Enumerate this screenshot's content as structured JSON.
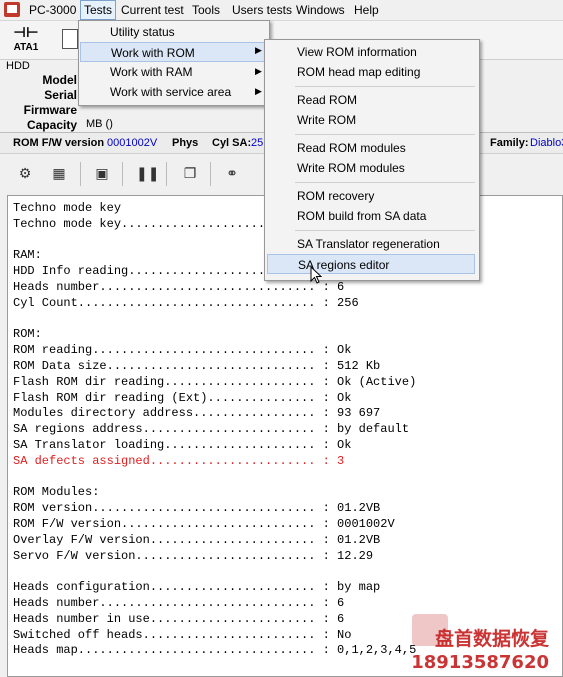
{
  "menubar": {
    "app_title": "PC-3000",
    "items": [
      "Tests",
      "Current test",
      "Tools",
      "Users tests",
      "Windows",
      "Help"
    ]
  },
  "toolbar": {
    "ata_label": "ATA1"
  },
  "hdd_panel": {
    "group_label": "HDD",
    "fields": [
      {
        "label": "Model",
        "value": ""
      },
      {
        "label": "Serial",
        "value": ""
      },
      {
        "label": "Firmware",
        "value": ""
      },
      {
        "label": "Capacity",
        "value": "MB ()"
      }
    ]
  },
  "infobar": {
    "rom_fw_label": "ROM F/W version",
    "rom_fw_value": "0001002V",
    "phys_label": "Phys",
    "cyl_sa_label": "Cyl SA:",
    "cyl_sa_value": "25",
    "family_label": "Family:",
    "family_value": "Diablo3"
  },
  "tests_menu": {
    "items": [
      {
        "label": "Utility status",
        "submenu": false
      },
      {
        "label": "Work with ROM",
        "submenu": true,
        "highlighted": true
      },
      {
        "label": "Work with RAM",
        "submenu": true
      },
      {
        "label": "Work with service area",
        "submenu": true
      }
    ]
  },
  "rom_menu": {
    "items": [
      {
        "label": "View ROM information"
      },
      {
        "label": "ROM head map editing"
      },
      {
        "label": "Read ROM"
      },
      {
        "label": "Write ROM"
      },
      {
        "label": "Read ROM modules"
      },
      {
        "label": "Write ROM modules"
      },
      {
        "label": "ROM recovery"
      },
      {
        "label": "ROM build from SA data"
      },
      {
        "label": "SA Translator regeneration"
      },
      {
        "label": "SA regions editor",
        "highlighted": true
      }
    ]
  },
  "console": {
    "lines": [
      {
        "text": "Techno mode key",
        "color": "#000000"
      },
      {
        "text": "Techno mode key...........................",
        "color": "#000000"
      },
      {
        "text": "",
        "color": "#000000"
      },
      {
        "text": "RAM:",
        "color": "#000000"
      },
      {
        "text": "HDD Info reading..........................",
        "color": "#000000"
      },
      {
        "text": "Heads number.............................. : 6",
        "color": "#000000"
      },
      {
        "text": "Cyl Count................................. : 256",
        "color": "#000000"
      },
      {
        "text": "",
        "color": "#000000"
      },
      {
        "text": "ROM:",
        "color": "#000000"
      },
      {
        "text": "ROM reading............................... : Ok",
        "color": "#000000"
      },
      {
        "text": "ROM Data size............................. : 512 Kb",
        "color": "#000000"
      },
      {
        "text": "Flash ROM dir reading..................... : Ok (Active)",
        "color": "#000000"
      },
      {
        "text": "Flash ROM dir reading (Ext)............... : Ok",
        "color": "#000000"
      },
      {
        "text": "Modules directory address................. : 93 697",
        "color": "#000000"
      },
      {
        "text": "SA regions address........................ : by default",
        "color": "#000000"
      },
      {
        "text": "SA Translator loading..................... : Ok",
        "color": "#000000"
      },
      {
        "text": "SA defects assigned....................... : 3",
        "color": "#e02020"
      },
      {
        "text": "",
        "color": "#000000"
      },
      {
        "text": "ROM Modules:",
        "color": "#000000"
      },
      {
        "text": "ROM version............................... : 01.2VB",
        "color": "#000000"
      },
      {
        "text": "ROM F/W version........................... : 0001002V",
        "color": "#000000"
      },
      {
        "text": "Overlay F/W version....................... : 01.2VB",
        "color": "#000000"
      },
      {
        "text": "Servo F/W version......................... : 12.29",
        "color": "#000000"
      },
      {
        "text": "",
        "color": "#000000"
      },
      {
        "text": "Heads configuration....................... : by map",
        "color": "#000000"
      },
      {
        "text": "Heads number.............................. : 6",
        "color": "#000000"
      },
      {
        "text": "Heads number in use....................... : 6",
        "color": "#000000"
      },
      {
        "text": "Switched off heads........................ : No",
        "color": "#000000"
      },
      {
        "text": "Heads map................................. : 0,1,2,3,4,5",
        "color": "#000000"
      }
    ]
  },
  "watermark": {
    "line1": "盘首数据恢复",
    "line2": "18913587620"
  },
  "icons": [
    "app-icon",
    "ata-connector-icon",
    "device-icon",
    "config-icon",
    "module-icon",
    "save-icon",
    "pause-icon",
    "copy-icon",
    "binoculars-icon",
    "submenu-arrow-icon",
    "mouse-cursor-icon"
  ]
}
